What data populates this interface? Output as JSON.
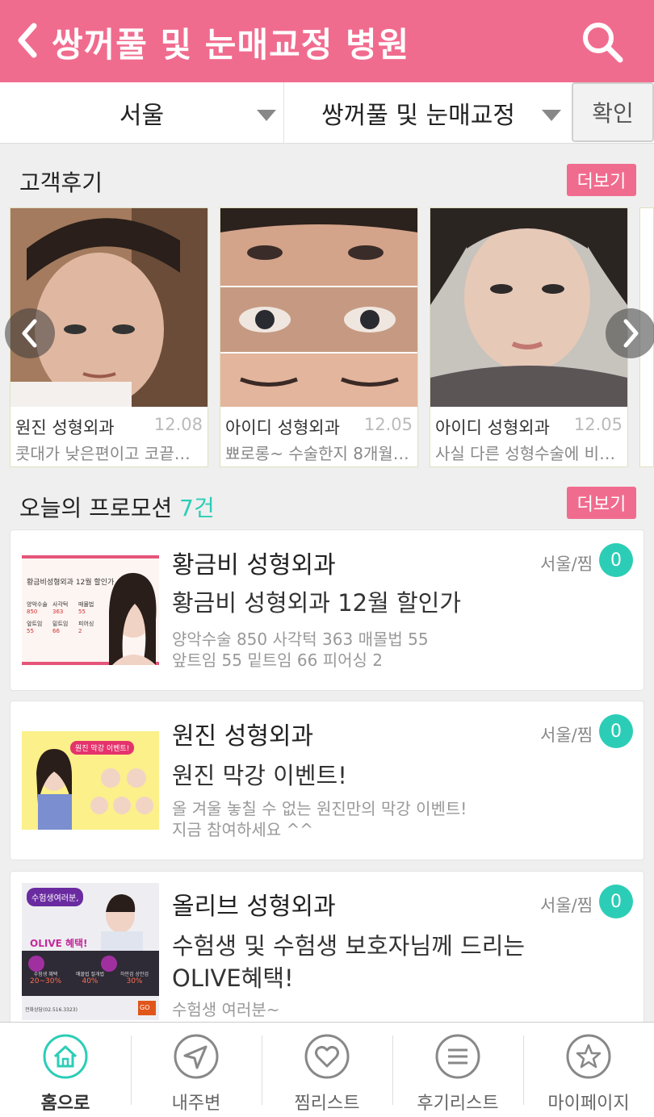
{
  "header": {
    "title": "쌍꺼풀 및 눈매교정 병원"
  },
  "filters": {
    "region": "서울",
    "category": "쌍꺼풀 및 눈매교정",
    "confirm_label": "확인"
  },
  "reviews": {
    "title": "고객후기",
    "more_label": "더보기",
    "items": [
      {
        "hospital": "원진 성형외과",
        "date": "12.08",
        "text": "콧대가 낮은편이고 코끝…"
      },
      {
        "hospital": "아이디 성형외과",
        "date": "12.05",
        "text": "뾰로롱~ 수술한지 8개월…"
      },
      {
        "hospital": "아이디 성형외과",
        "date": "12.05",
        "text": "사실 다른 성형수술에 비…"
      }
    ]
  },
  "promotions": {
    "title": "오늘의 프로모션",
    "count": "7건",
    "more_label": "더보기",
    "items": [
      {
        "hospital": "황금비 성형외과",
        "location": "서울/찜",
        "zzim": "0",
        "title": "황금비 성형외과 12월 할인가",
        "desc": "양악수술 850 사각턱 363 매몰법 55\n앞트임 55 밑트임 66 피어싱 2",
        "thumb": {
          "heading": "황금비성형외과 12월 할인가",
          "prices": [
            {
              "label": "양악수술",
              "value": "850"
            },
            {
              "label": "사각턱",
              "value": "363"
            },
            {
              "label": "매몰법",
              "value": "55"
            },
            {
              "label": "앞트임",
              "value": "55"
            },
            {
              "label": "밑트임",
              "value": "66"
            },
            {
              "label": "피어싱",
              "value": "2"
            }
          ]
        }
      },
      {
        "hospital": "원진 성형외과",
        "location": "서울/찜",
        "zzim": "0",
        "title": "원진 막강 이벤트!",
        "desc": "올 겨울 놓칠 수 없는 원진만의 막강 이벤트!\n지금 참여하세요 ^^",
        "thumb": {
          "heading": "원진 막강 이벤트!"
        }
      },
      {
        "hospital": "올리브 성형외과",
        "location": "서울/찜",
        "zzim": "0",
        "title": "수험생 및 수험생 보호자님께 드리는 OLIVE혜택!",
        "desc": "수험생 여러분~",
        "thumb": {
          "bubble": "수험생여러분,",
          "heading": "OLIVE 혜택!",
          "cols": [
            {
              "label": "수험생 혜택",
              "value": "20~30%"
            },
            {
              "label": "매몰법 절개법",
              "value": "40%"
            },
            {
              "label": "하안검 상안검",
              "value": "30%"
            }
          ],
          "phone": "전화상담(02.516.3323)",
          "go": "GO"
        }
      }
    ]
  },
  "tabs": [
    {
      "label": "홈으로",
      "icon": "home-icon",
      "active": true
    },
    {
      "label": "내주변",
      "icon": "location-arrow-icon",
      "active": false
    },
    {
      "label": "찜리스트",
      "icon": "heart-icon",
      "active": false
    },
    {
      "label": "후기리스트",
      "icon": "list-icon",
      "active": false
    },
    {
      "label": "마이페이지",
      "icon": "star-icon",
      "active": false
    }
  ],
  "colors": {
    "brand": "#f06c8e",
    "accent": "#2ccdb6"
  }
}
